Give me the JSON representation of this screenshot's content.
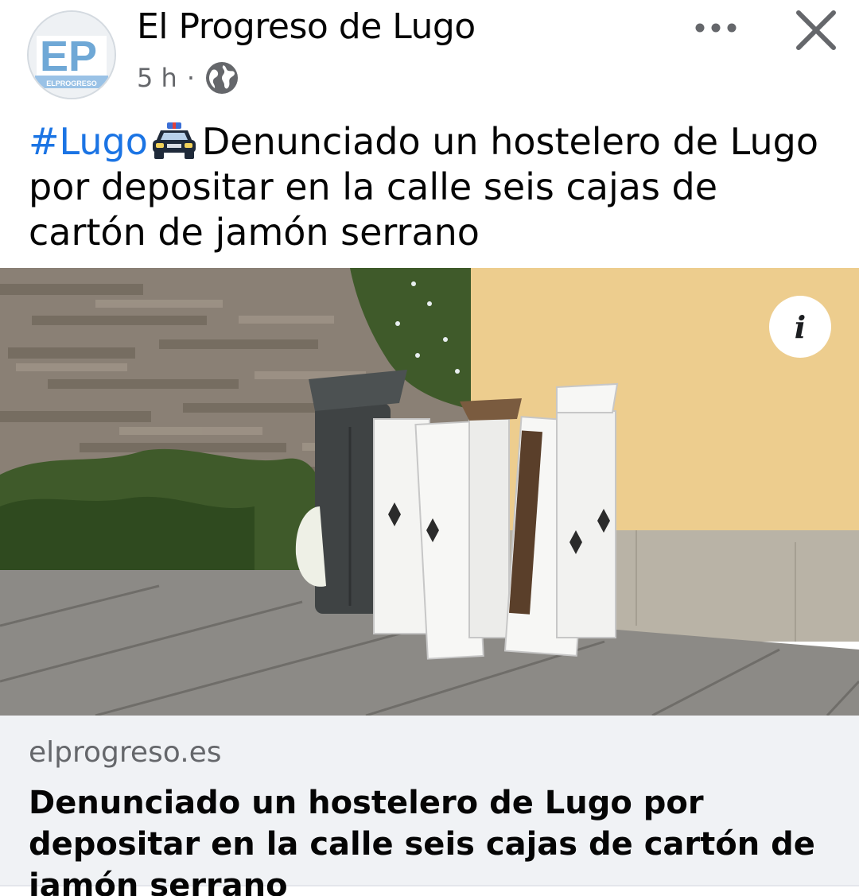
{
  "post": {
    "page_name": "El Progreso de Lugo",
    "time": "5 h",
    "separator": "·",
    "audience_icon": "globe-icon",
    "more_icon": "more-horizontal-icon",
    "close_icon": "close-icon",
    "avatar": {
      "logo_text": "EP",
      "logo_subtext": "ELPROGRESO"
    },
    "caption": {
      "hashtag": "#Lugo",
      "emoji": "police-car-icon",
      "text": "Denunciado un hostelero de Lugo por depositar en la calle seis cajas de cartón de jamón serrano"
    },
    "image": {
      "info_button_label": "i",
      "info_icon": "info-icon"
    },
    "link_preview": {
      "domain": "elprogreso.es",
      "headline": "Denunciado un hostelero de Lugo por depositar en la calle seis cajas de cartón de jamón serrano"
    }
  },
  "colors": {
    "hashtag": "#1b74e4",
    "text": "#050505",
    "secondary": "#65676b",
    "preview_bg": "#f0f2f5"
  }
}
